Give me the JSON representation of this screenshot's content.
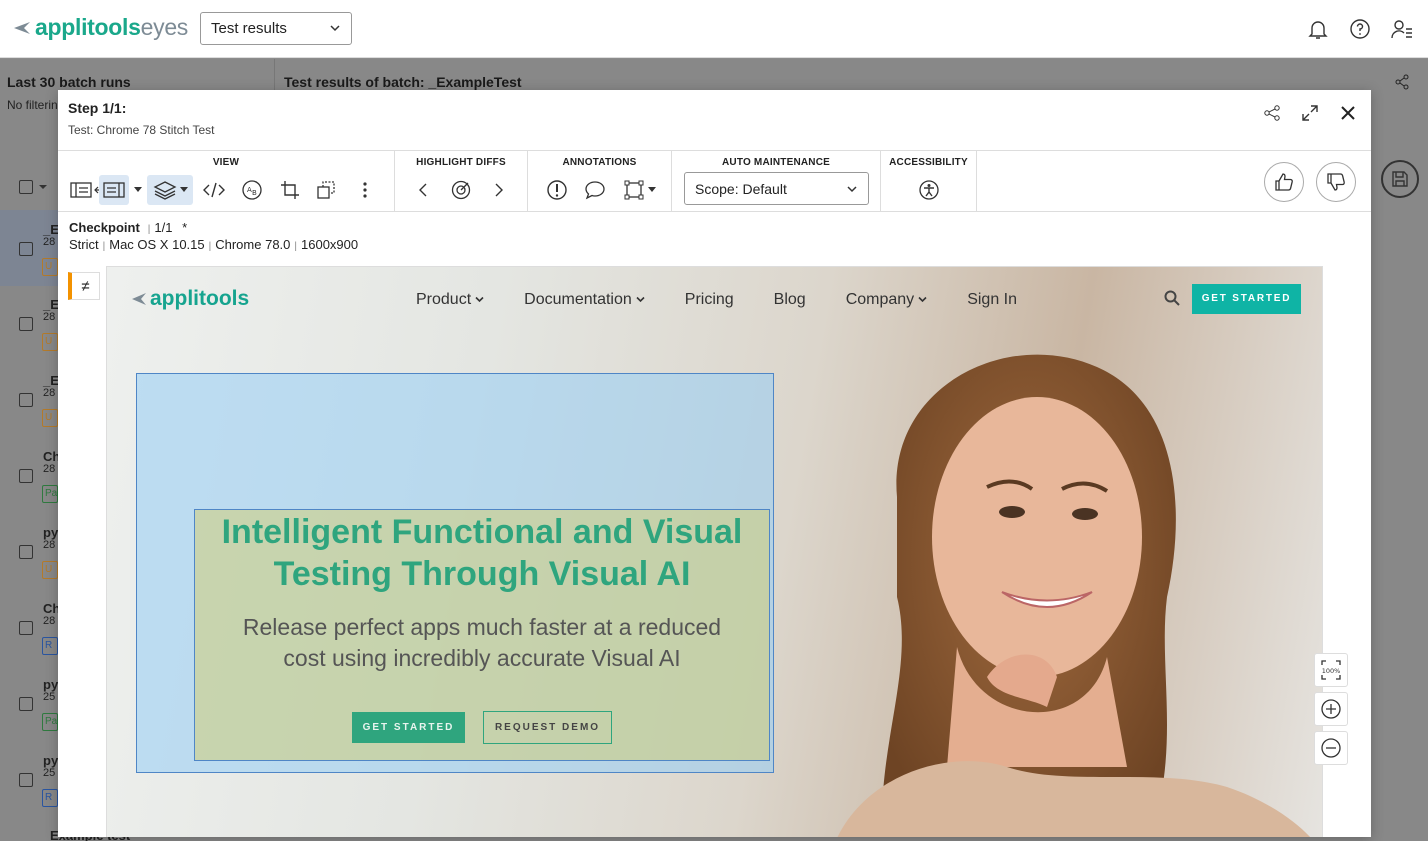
{
  "app": {
    "brand": "applitools",
    "product": "eyes"
  },
  "topbar": {
    "select_value": "Test results"
  },
  "background": {
    "left_title": "Last 30 batch runs",
    "left_sub": "No filterin",
    "right_title": "Test results of batch: _ExampleTest",
    "rows": [
      {
        "name": "_E",
        "num": "28",
        "badge": "U",
        "badge_color": "#b37a2a"
      },
      {
        "name": "_E",
        "num": "28",
        "badge": "U",
        "badge_color": "#b37a2a"
      },
      {
        "name": "_E",
        "num": "28",
        "badge": "U",
        "badge_color": "#b37a2a"
      },
      {
        "name": "Ch",
        "num": "28",
        "badge": "Pa",
        "badge_color": "#2f7a3f"
      },
      {
        "name": "py",
        "num": "28",
        "badge": "U",
        "badge_color": "#b37a2a"
      },
      {
        "name": "Ch",
        "num": "28",
        "badge": "R",
        "badge_color": "#2a55a0"
      },
      {
        "name": "py",
        "num": "25",
        "badge": "Pa",
        "badge_color": "#2f7a3f"
      },
      {
        "name": "py",
        "num": "25",
        "badge": "R",
        "badge_color": "#2a55a0"
      }
    ],
    "bottom_text": "Example test"
  },
  "modal": {
    "title": "Step 1/1:",
    "subtitle": "Test: Chrome 78 Stitch Test",
    "toolbar": {
      "view_title": "VIEW",
      "highlight_title": "HIGHLIGHT DIFFS",
      "annotations_title": "ANNOTATIONS",
      "auto_title": "AUTO MAINTENANCE",
      "accessibility_title": "ACCESSIBILITY",
      "scope": "Scope: Default"
    },
    "checkpoint": {
      "label": "Checkpoint",
      "count": "1/1",
      "asterisk": "*",
      "match_level": "Strict",
      "os": "Mac OS X 10.15",
      "browser": "Chrome 78.0",
      "viewport": "1600x900"
    },
    "diff_flag": "≠"
  },
  "screenshot": {
    "logo": "applitools",
    "nav": [
      "Product",
      "Documentation",
      "Pricing",
      "Blog",
      "Company",
      "Sign In"
    ],
    "cta": "GET STARTED",
    "hero_title_1": "Intelligent Functional and Visual",
    "hero_title_2": "Testing Through Visual AI",
    "hero_sub_1": "Release perfect apps much faster at a reduced",
    "hero_sub_2": "cost using incredibly accurate Visual AI",
    "btn_primary": "GET STARTED",
    "btn_secondary": "REQUEST DEMO"
  },
  "zoom": {
    "fit_label": "100%"
  }
}
